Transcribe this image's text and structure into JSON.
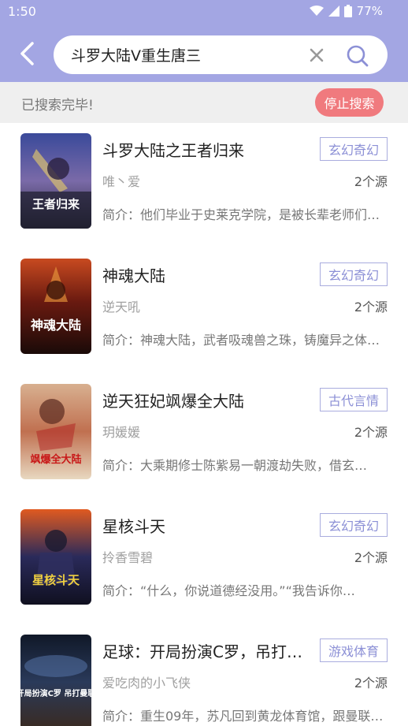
{
  "status_bar": {
    "time": "1:50",
    "battery": "77%"
  },
  "search": {
    "query": "斗罗大陆V重生唐三"
  },
  "search_status": {
    "message": "已搜索完毕!",
    "stop_label": "停止搜索"
  },
  "colors": {
    "header": "#a3a6e3",
    "accent": "#8c90d6",
    "stop_button": "#f07a7e"
  },
  "books": [
    {
      "title": "斗罗大陆之王者归来",
      "tag": "玄幻奇幻",
      "author": "唯丶爱",
      "sources": "2个源",
      "intro": "简介：他们毕业于史莱克学院，是被长辈老师们寄予厚望的一代…",
      "cover_text": "王者归来"
    },
    {
      "title": "神魂大陆",
      "tag": "玄幻奇幻",
      "author": "逆天吼",
      "sources": "2个源",
      "intro": "简介：神魂大陆，武者吸魂兽之珠，铸魔异之体…",
      "cover_text": "神魂大陆"
    },
    {
      "title": "逆天狂妃飒爆全大陆",
      "tag": "古代言情",
      "author": "玥媛媛",
      "sources": "2个源",
      "intro": "简介：大乘期修士陈紫易一朝渡劫失败，借玄…",
      "cover_text": "飒爆全大陆"
    },
    {
      "title": "星核斗天",
      "tag": "玄幻奇幻",
      "author": "拎香雪碧",
      "sources": "2个源",
      "intro": "简介：“什么，你说道德经没用。”“我告诉你…",
      "cover_text": "星核斗天"
    },
    {
      "title": "足球：开局扮演C罗，吊打曼联",
      "tag": "游戏体育",
      "author": "爱吃肉的小飞侠",
      "sources": "2个源",
      "intro": "简介：重生09年，苏凡回到黄龙体育馆，跟曼联…",
      "cover_text": "开局扮演C罗 吊打曼联"
    }
  ]
}
